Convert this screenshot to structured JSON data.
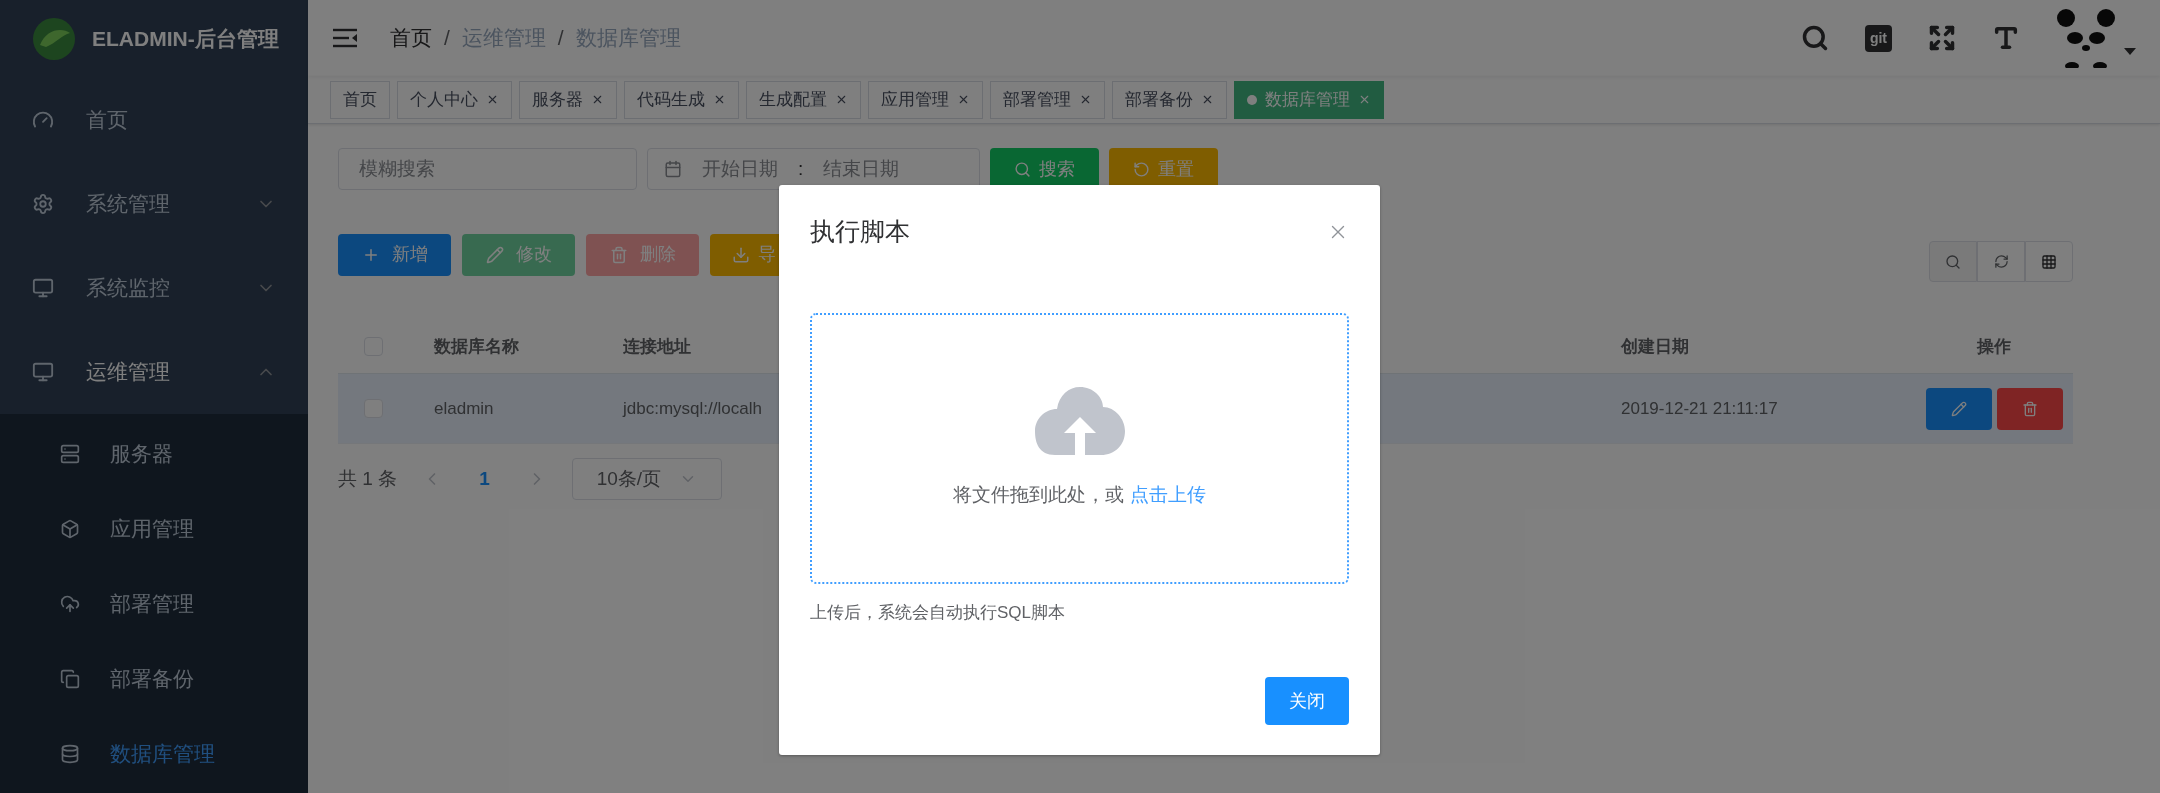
{
  "app": {
    "title": "ELADMIN-后台管理"
  },
  "sidebar": {
    "items": [
      {
        "label": "首页",
        "selected": false
      },
      {
        "label": "系统管理",
        "selected": false,
        "expanded": false
      },
      {
        "label": "系统监控",
        "selected": false,
        "expanded": false
      },
      {
        "label": "运维管理",
        "selected": false,
        "expanded": true,
        "children": [
          {
            "label": "服务器",
            "selected": false
          },
          {
            "label": "应用管理",
            "selected": false
          },
          {
            "label": "部署管理",
            "selected": false
          },
          {
            "label": "部署备份",
            "selected": false
          },
          {
            "label": "数据库管理",
            "selected": true
          }
        ]
      }
    ]
  },
  "breadcrumb": [
    "首页",
    "运维管理",
    "数据库管理"
  ],
  "breadcrumb_separator": "/",
  "header": {
    "git_badge": "git"
  },
  "tags": [
    {
      "label": "首页",
      "closable": false,
      "selected": false
    },
    {
      "label": "个人中心",
      "closable": true,
      "selected": false
    },
    {
      "label": "服务器",
      "closable": true,
      "selected": false
    },
    {
      "label": "代码生成",
      "closable": true,
      "selected": false
    },
    {
      "label": "生成配置",
      "closable": true,
      "selected": false
    },
    {
      "label": "应用管理",
      "closable": true,
      "selected": false
    },
    {
      "label": "部署管理",
      "closable": true,
      "selected": false
    },
    {
      "label": "部署备份",
      "closable": true,
      "selected": false
    },
    {
      "label": "数据库管理",
      "closable": true,
      "selected": true
    }
  ],
  "filters": {
    "search": {
      "placeholder": "模糊搜索"
    },
    "date_range": {
      "start_placeholder": "开始日期",
      "separator": ":",
      "end_placeholder": "结束日期"
    },
    "buttons": [
      {
        "label": "搜索",
        "kind": "search"
      },
      {
        "label": "重置",
        "kind": "reset"
      }
    ]
  },
  "toolbar": {
    "buttons": [
      {
        "label": "新增",
        "kind": "add",
        "disabled": false
      },
      {
        "label": "修改",
        "kind": "edit",
        "disabled": true
      },
      {
        "label": "删除",
        "kind": "delete",
        "disabled": true
      },
      {
        "label": "导",
        "kind": "export",
        "disabled": false
      }
    ]
  },
  "table": {
    "select_all": {
      "checked": false
    },
    "columns": [
      {
        "label": "数据库名称"
      },
      {
        "label": "连接地址"
      },
      {
        "label": "创建日期"
      },
      {
        "label": "操作"
      }
    ],
    "rows": [
      {
        "checked": false,
        "highlighted": true,
        "name": "eladmin",
        "url": "jdbc:mysql://localh",
        "created": "2019-12-21 21:11:17"
      }
    ]
  },
  "pagination": {
    "total": "共 1 条",
    "pages": [
      {
        "label": "1",
        "selected": true
      }
    ],
    "page_size": "10条/页"
  },
  "dialog": {
    "title": "执行脚本",
    "upload_text": "将文件拖到此处，或",
    "upload_link": "点击上传",
    "tip": "上传后，系统会自动执行SQL脚本",
    "buttons": [
      "关闭"
    ]
  }
}
